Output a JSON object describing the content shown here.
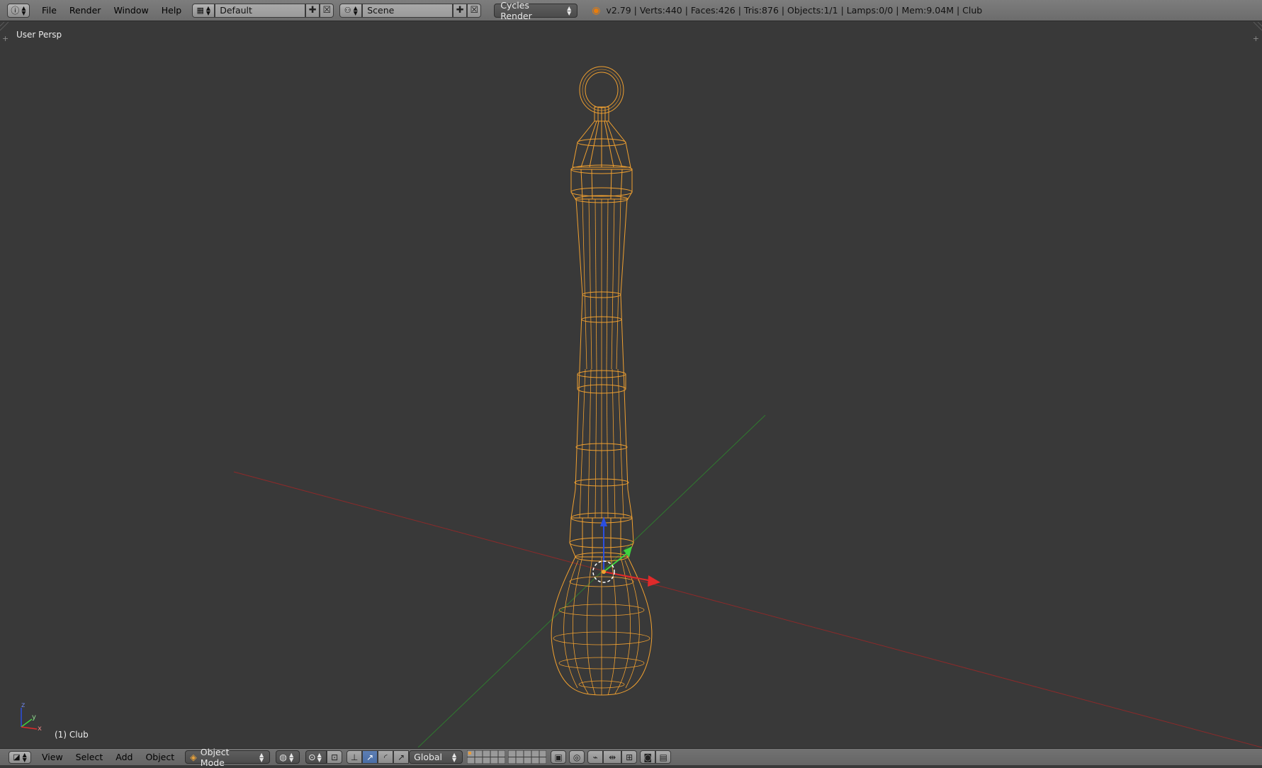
{
  "top": {
    "editor_icon": "info-icon",
    "menus": [
      "File",
      "Render",
      "Window",
      "Help"
    ],
    "layout_name": "Default",
    "scene_name": "Scene",
    "render_engine": "Cycles Render",
    "stats": "v2.79 | Verts:440 | Faces:426 | Tris:876 | Objects:1/1 | Lamps:0/0 | Mem:9.04M | Club"
  },
  "viewport": {
    "view_name": "User Persp",
    "object_label": "(1) Club",
    "axis_labels": {
      "z": "z",
      "y": "y",
      "x": "x"
    },
    "wire_color": "#f0a030",
    "bg_color": "#393939"
  },
  "bottom": {
    "menus": [
      "View",
      "Select",
      "Add",
      "Object"
    ],
    "mode": "Object Mode",
    "orientation": "Global"
  }
}
